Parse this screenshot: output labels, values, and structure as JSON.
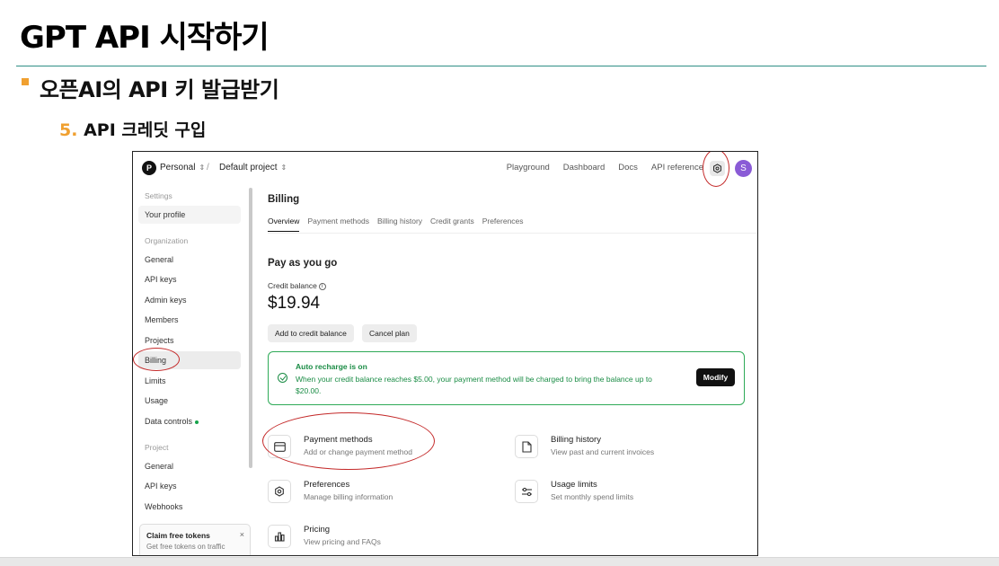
{
  "slide": {
    "title": "GPT API 시작하기",
    "subtitle": "오픈AI의 API 키 발급받기",
    "step_number": "5.",
    "step_text": " API 크레딧 구입"
  },
  "topbar": {
    "org_initial": "P",
    "org_name": "Personal",
    "separator": "/",
    "project_name": "Default project",
    "links": [
      "Playground",
      "Dashboard",
      "Docs",
      "API reference"
    ],
    "avatar_initial": "S"
  },
  "sidebar": {
    "settings_label": "Settings",
    "profile": "Your profile",
    "organization_label": "Organization",
    "org_items": [
      "General",
      "API keys",
      "Admin keys",
      "Members",
      "Projects",
      "Billing",
      "Limits",
      "Usage",
      "Data controls"
    ],
    "project_label": "Project",
    "project_items": [
      "General",
      "API keys",
      "Webhooks"
    ],
    "promo_title": "Claim free tokens",
    "promo_text": "Get free tokens on traffic",
    "promo_close": "×"
  },
  "main": {
    "title": "Billing",
    "tabs": [
      "Overview",
      "Payment methods",
      "Billing history",
      "Credit grants",
      "Preferences"
    ],
    "plan": "Pay as you go",
    "credit_label": "Credit balance",
    "credit_amount": "$19.94",
    "add_credit": "Add to credit balance",
    "cancel_plan": "Cancel plan",
    "recharge_title": "Auto recharge is on",
    "recharge_text": "When your credit balance reaches $5.00, your payment method will be charged to bring the balance up to $20.00.",
    "modify": "Modify",
    "cards": [
      {
        "title": "Payment methods",
        "desc": "Add or change payment method",
        "icon": "credit-card-icon"
      },
      {
        "title": "Billing history",
        "desc": "View past and current invoices",
        "icon": "document-icon"
      },
      {
        "title": "Preferences",
        "desc": "Manage billing information",
        "icon": "gear-icon"
      },
      {
        "title": "Usage limits",
        "desc": "Set monthly spend limits",
        "icon": "sliders-icon"
      },
      {
        "title": "Pricing",
        "desc": "View pricing and FAQs",
        "icon": "bar-chart-icon"
      }
    ]
  },
  "colors": {
    "accent_orange": "#f0a030",
    "rule_teal": "#2f8f86",
    "success_green": "#1a8c45",
    "annotation_red": "#c42a2a",
    "avatar_purple": "#8a5bd6"
  }
}
